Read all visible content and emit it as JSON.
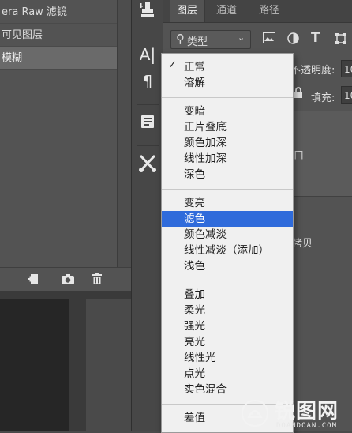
{
  "history": {
    "items": [
      "era Raw 滤镜",
      "可见图层",
      "模糊"
    ],
    "selected_index": 2,
    "footer_icons": [
      "new-document-from-state-icon",
      "camera-icon",
      "trash-icon"
    ]
  },
  "tools": [
    "stamp-icon",
    "character-icon",
    "paragraph-icon",
    "properties-icon",
    "tool-presets-icon"
  ],
  "tool_glyphs": {
    "character": "A|",
    "paragraph": "¶"
  },
  "layers_panel": {
    "tabs": [
      "图层",
      "通道",
      "路径"
    ],
    "active_tab": 0,
    "filter_label": "类型",
    "opacity_label": "不透明度:",
    "opacity_value": "10",
    "fill_label": "填充:",
    "fill_value": "10",
    "layer_name_partial": "拷贝",
    "layer_chevron": "ㄇ"
  },
  "blend_menu": {
    "groups": [
      [
        "正常",
        "溶解"
      ],
      [
        "变暗",
        "正片叠底",
        "颜色加深",
        "线性加深",
        "深色"
      ],
      [
        "变亮",
        "滤色",
        "颜色减淡",
        "线性减淡（添加）",
        "浅色"
      ],
      [
        "叠加",
        "柔光",
        "强光",
        "亮光",
        "线性光",
        "点光",
        "实色混合"
      ],
      [
        "差值"
      ]
    ],
    "checked": "正常",
    "highlighted": "滤色",
    "highlight_color": "#2f6bdb"
  },
  "watermark": {
    "text": "锐图网",
    "sub": "DOANDOAN.COM"
  }
}
